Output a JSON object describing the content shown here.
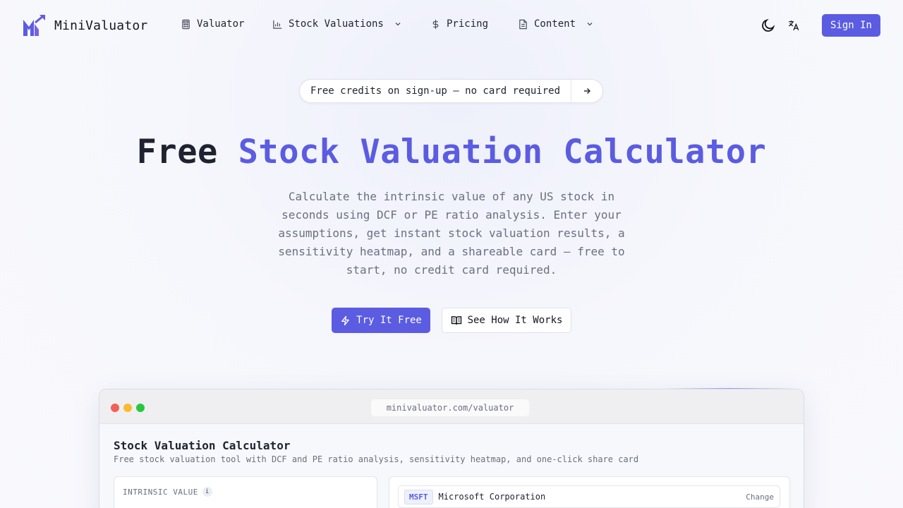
{
  "brand": {
    "name": "MiniValuator",
    "logo_icon": "m-arrow-logo-icon",
    "accent": "#5b5ce2"
  },
  "nav": {
    "items": [
      {
        "label": "Valuator",
        "icon": "calculator-icon",
        "has_dropdown": false
      },
      {
        "label": "Stock Valuations",
        "icon": "bar-chart-icon",
        "has_dropdown": true
      },
      {
        "label": "Pricing",
        "icon": "dollar-icon",
        "has_dropdown": false
      },
      {
        "label": "Content",
        "icon": "document-icon",
        "has_dropdown": true
      }
    ],
    "theme_icon": "moon-icon",
    "language_icon": "translate-icon",
    "sign_in_label": "Sign In"
  },
  "announcement": {
    "text": "Free credits on sign-up — no card required",
    "icon": "arrow-right-icon"
  },
  "hero": {
    "title_plain": "Free ",
    "title_accent": "Stock Valuation Calculator",
    "subtitle": "Calculate the intrinsic value of any US stock in seconds using DCF or PE ratio analysis. Enter your assumptions, get instant stock valuation results, a sensitivity heatmap, and a shareable card — free to start, no credit card required.",
    "primary_cta": "Try It Free",
    "primary_icon": "lightning-icon",
    "secondary_cta": "See How It Works",
    "secondary_icon": "open-book-icon"
  },
  "preview": {
    "url": "minivaluator.com/valuator",
    "window_dots": [
      "#f25f57",
      "#f8bc2f",
      "#29c73f"
    ],
    "title": "Stock Valuation Calculator",
    "subtitle": "Free stock valuation tool with DCF and PE ratio analysis, sensitivity heatmap, and one-click share card",
    "intrinsic_label": "INTRINSIC VALUE",
    "info_glyph": "i",
    "ticker": "MSFT",
    "company": "Microsoft Corporation",
    "change_label": "Change"
  }
}
